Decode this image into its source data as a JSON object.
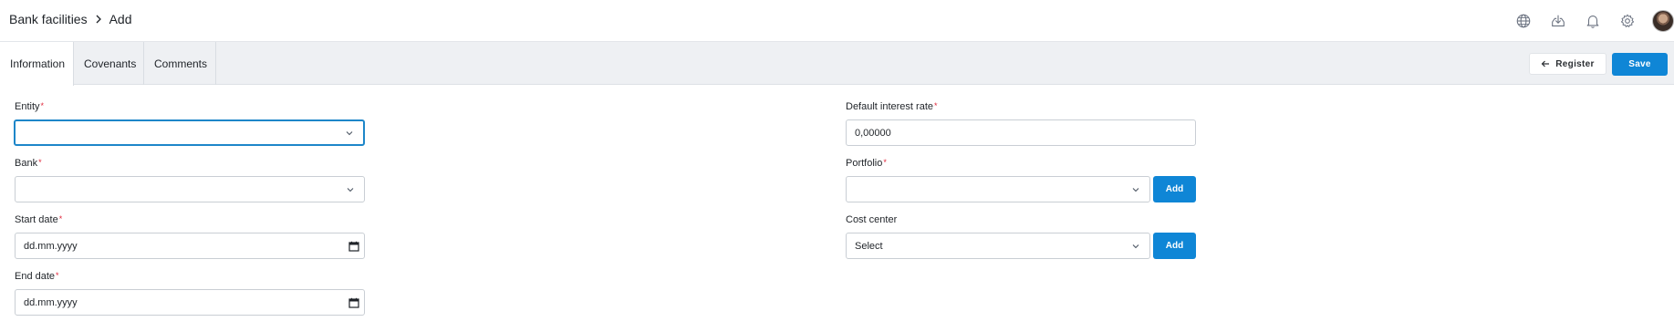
{
  "breadcrumb": {
    "parent": "Bank facilities",
    "current": "Add"
  },
  "top_icons": [
    "globe-icon",
    "download-icon",
    "bell-icon",
    "gear-icon"
  ],
  "tabs": [
    {
      "label": "Information",
      "active": true
    },
    {
      "label": "Covenants",
      "active": false
    },
    {
      "label": "Comments",
      "active": false
    }
  ],
  "actions": {
    "register_label": "Register",
    "save_label": "Save"
  },
  "form": {
    "entity": {
      "label": "Entity",
      "value": ""
    },
    "bank": {
      "label": "Bank",
      "value": ""
    },
    "start_date": {
      "label": "Start date",
      "value": "dd.mm.yyyy"
    },
    "end_date": {
      "label": "End date",
      "value": "dd.mm.yyyy"
    },
    "default_interest_rate": {
      "label": "Default interest rate",
      "value": "0,00000"
    },
    "portfolio": {
      "label": "Portfolio",
      "value": "",
      "add_label": "Add"
    },
    "cost_center": {
      "label": "Cost center",
      "value": "Select",
      "add_label": "Add"
    }
  },
  "colors": {
    "primary": "#0f86d6",
    "required": "#e0283b",
    "tabbar_bg": "#eef0f3"
  }
}
